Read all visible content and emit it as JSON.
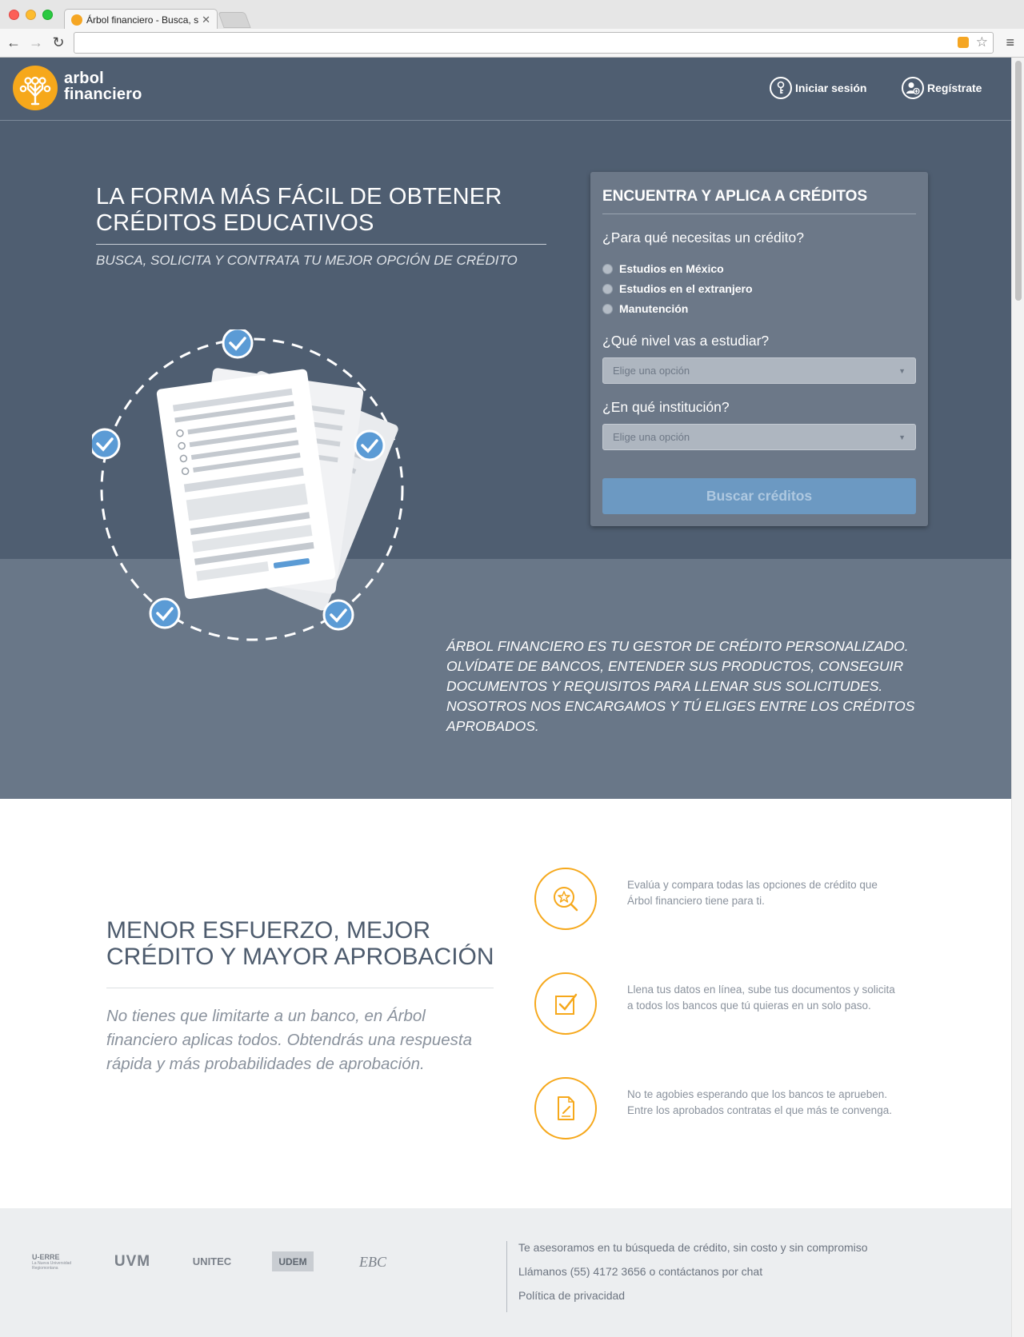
{
  "browser": {
    "tab_title": "Árbol financiero - Busca, s",
    "tab_close": "✕",
    "url": ""
  },
  "header": {
    "logo_line1": "arbol",
    "logo_line2": "financiero",
    "login_label": "Iniciar sesión",
    "register_label": "Regístrate"
  },
  "hero": {
    "title_line1": "La forma más fácil de obtener",
    "title_line2": "créditos educativos",
    "subtitle": "Busca, solicita y contrata tu mejor opción de crédito",
    "description": "Árbol financiero es tu gestor de crédito personalizado. Olvídate de bancos, entender sus productos, conseguir documentos y requisitos para llenar sus solicitudes. Nosotros nos encargamos y tú eliges entre los créditos aprobados."
  },
  "search_card": {
    "title": "Encuentra y aplica a créditos",
    "question1": "¿Para qué necesitas un crédito?",
    "options": [
      "Estudios en México",
      "Estudios en el extranjero",
      "Manutención"
    ],
    "question2": "¿Qué nivel vas a estudiar?",
    "level_placeholder": "Elige una opción",
    "question3": "¿En qué institución?",
    "institution_placeholder": "Elige una opción",
    "button_label": "Buscar créditos"
  },
  "features": {
    "title_line1": "Menor esfuerzo, mejor",
    "title_line2": "crédito y mayor aprobación",
    "subtitle": "No tienes que limitarte a un banco, en Árbol financiero aplicas todos. Obtendrás una respuesta rápida y más probabilidades de aprobación.",
    "items": [
      {
        "icon": "search-star-icon",
        "text": "Evalúa y compara todas las opciones de crédito que Árbol financiero tiene para ti."
      },
      {
        "icon": "checkbox-icon",
        "text": "Llena tus datos en línea, sube tus documentos y solicita a todos los bancos que tú quieras en un solo paso."
      },
      {
        "icon": "document-sign-icon",
        "text": "No te agobies esperando que los bancos te aprueben. Entre los aprobados contratas el que más te convenga."
      }
    ]
  },
  "footer": {
    "partners": {
      "uerre": "U-ERRE",
      "uerre_sub": "La Nueva Universidad Regiomontana",
      "uvm": "UVM",
      "unitec": "UNITEC",
      "udem": "UDEM",
      "ebc": "EBC"
    },
    "line1": "Te asesoramos en tu búsqueda de crédito, sin costo y sin compromiso",
    "line2": "Llámanos (55) 4172 3656 o contáctanos por chat",
    "line3": "Política de privacidad"
  },
  "colors": {
    "brand_orange": "#f6a81b",
    "hero_dark": "#4f5e71",
    "hero_light": "#697788",
    "accent_blue": "#5b9bd5"
  }
}
